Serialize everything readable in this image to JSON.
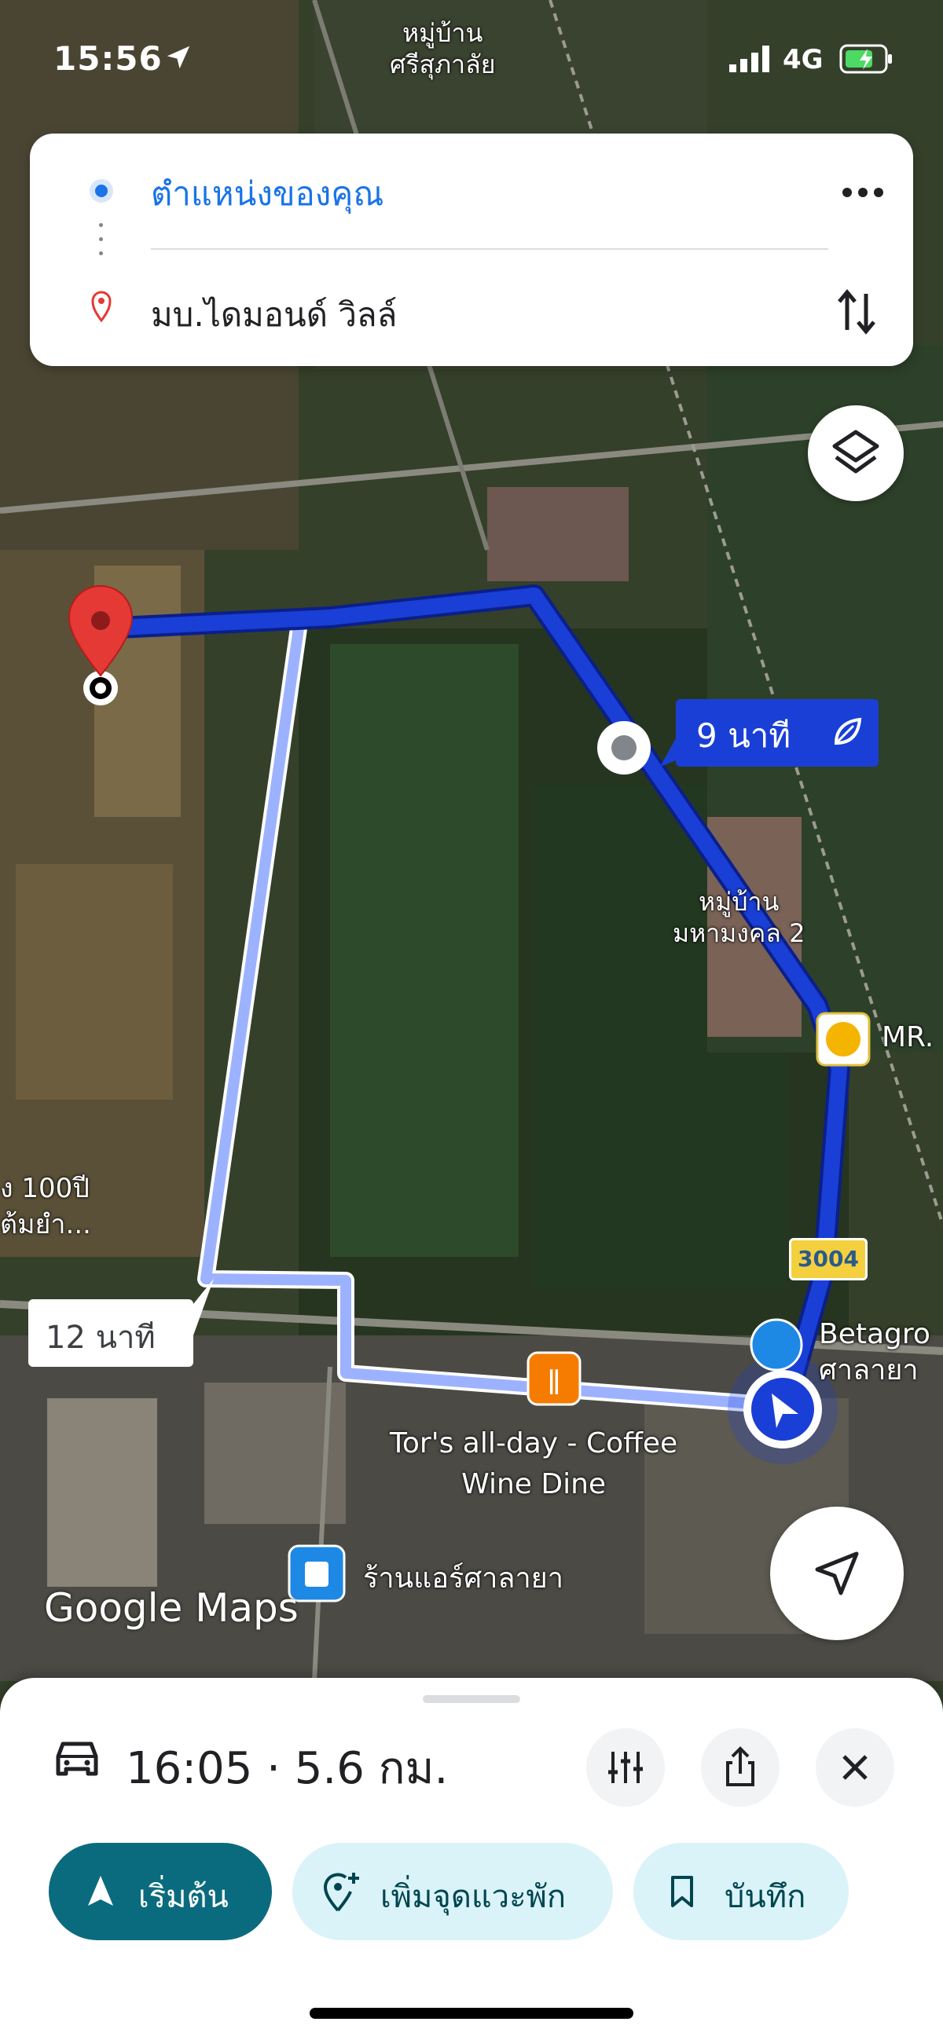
{
  "status_bar": {
    "time": "15:56",
    "network": "4G"
  },
  "directions": {
    "origin": "ตำแหน่งของคุณ",
    "destination": "มบ.ไดมอนด์ วิลล์"
  },
  "map": {
    "labels": {
      "village_top": "หมู่บ้าน\nศรีสุภาลัย",
      "village_mid": "หมู่บ้าน\nมหามงคล 2",
      "mr_label": "MR.",
      "left_partial": "ง 100ปี\nต้มยำ...",
      "betagro": "Betagro\nศาลายา",
      "tors": "Tor's all-day - Coffee\nWine Dine",
      "air_shop": "ร้านแอร์ศาลายา",
      "road_number": "3004",
      "logo": "Google Maps"
    },
    "route_callouts": {
      "main": "9 นาที",
      "alternate": "12 นาที"
    }
  },
  "bottom_sheet": {
    "summary": "16:05 · 5.6 กม.",
    "buttons": {
      "start": "เริ่มต้น",
      "add_stop": "เพิ่มจุดแวะพัก",
      "save": "บันทึก"
    }
  },
  "colors": {
    "route_primary": "#1a3fd6",
    "route_alternate": "#9db2ff",
    "accent_teal": "#0b6b7e",
    "pin_red": "#e53935"
  }
}
